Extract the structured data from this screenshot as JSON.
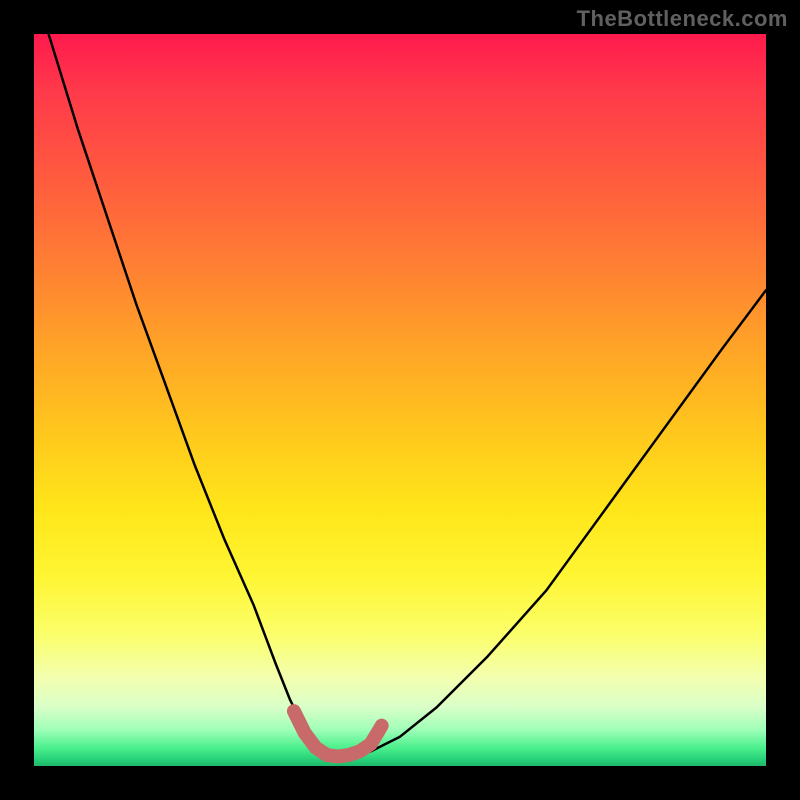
{
  "attribution": "TheBottleneck.com",
  "chart_data": {
    "type": "line",
    "title": "",
    "xlabel": "",
    "ylabel": "",
    "xlim": [
      0,
      100
    ],
    "ylim": [
      0,
      100
    ],
    "grid": false,
    "series": [
      {
        "name": "black-curve",
        "color": "#000000",
        "stroke_width": 2.5,
        "x": [
          2,
          6,
          10,
          14,
          18,
          22,
          26,
          30,
          33,
          35,
          37,
          39,
          41,
          43,
          46,
          50,
          55,
          62,
          70,
          78,
          86,
          94,
          100
        ],
        "values": [
          100,
          87,
          75,
          63,
          52,
          41,
          31,
          22,
          14,
          9,
          5,
          2.5,
          1.5,
          1.5,
          2,
          4,
          8,
          15,
          24,
          35,
          46,
          57,
          65
        ]
      },
      {
        "name": "trough-marker",
        "color": "#c96a6a",
        "stroke_width": 14,
        "linecap": "round",
        "x": [
          35.5,
          37,
          38.5,
          40,
          41.5,
          43,
          44.5,
          46,
          47.5
        ],
        "values": [
          7.5,
          4.5,
          2.5,
          1.5,
          1.3,
          1.5,
          2,
          3,
          5.5
        ]
      }
    ]
  }
}
